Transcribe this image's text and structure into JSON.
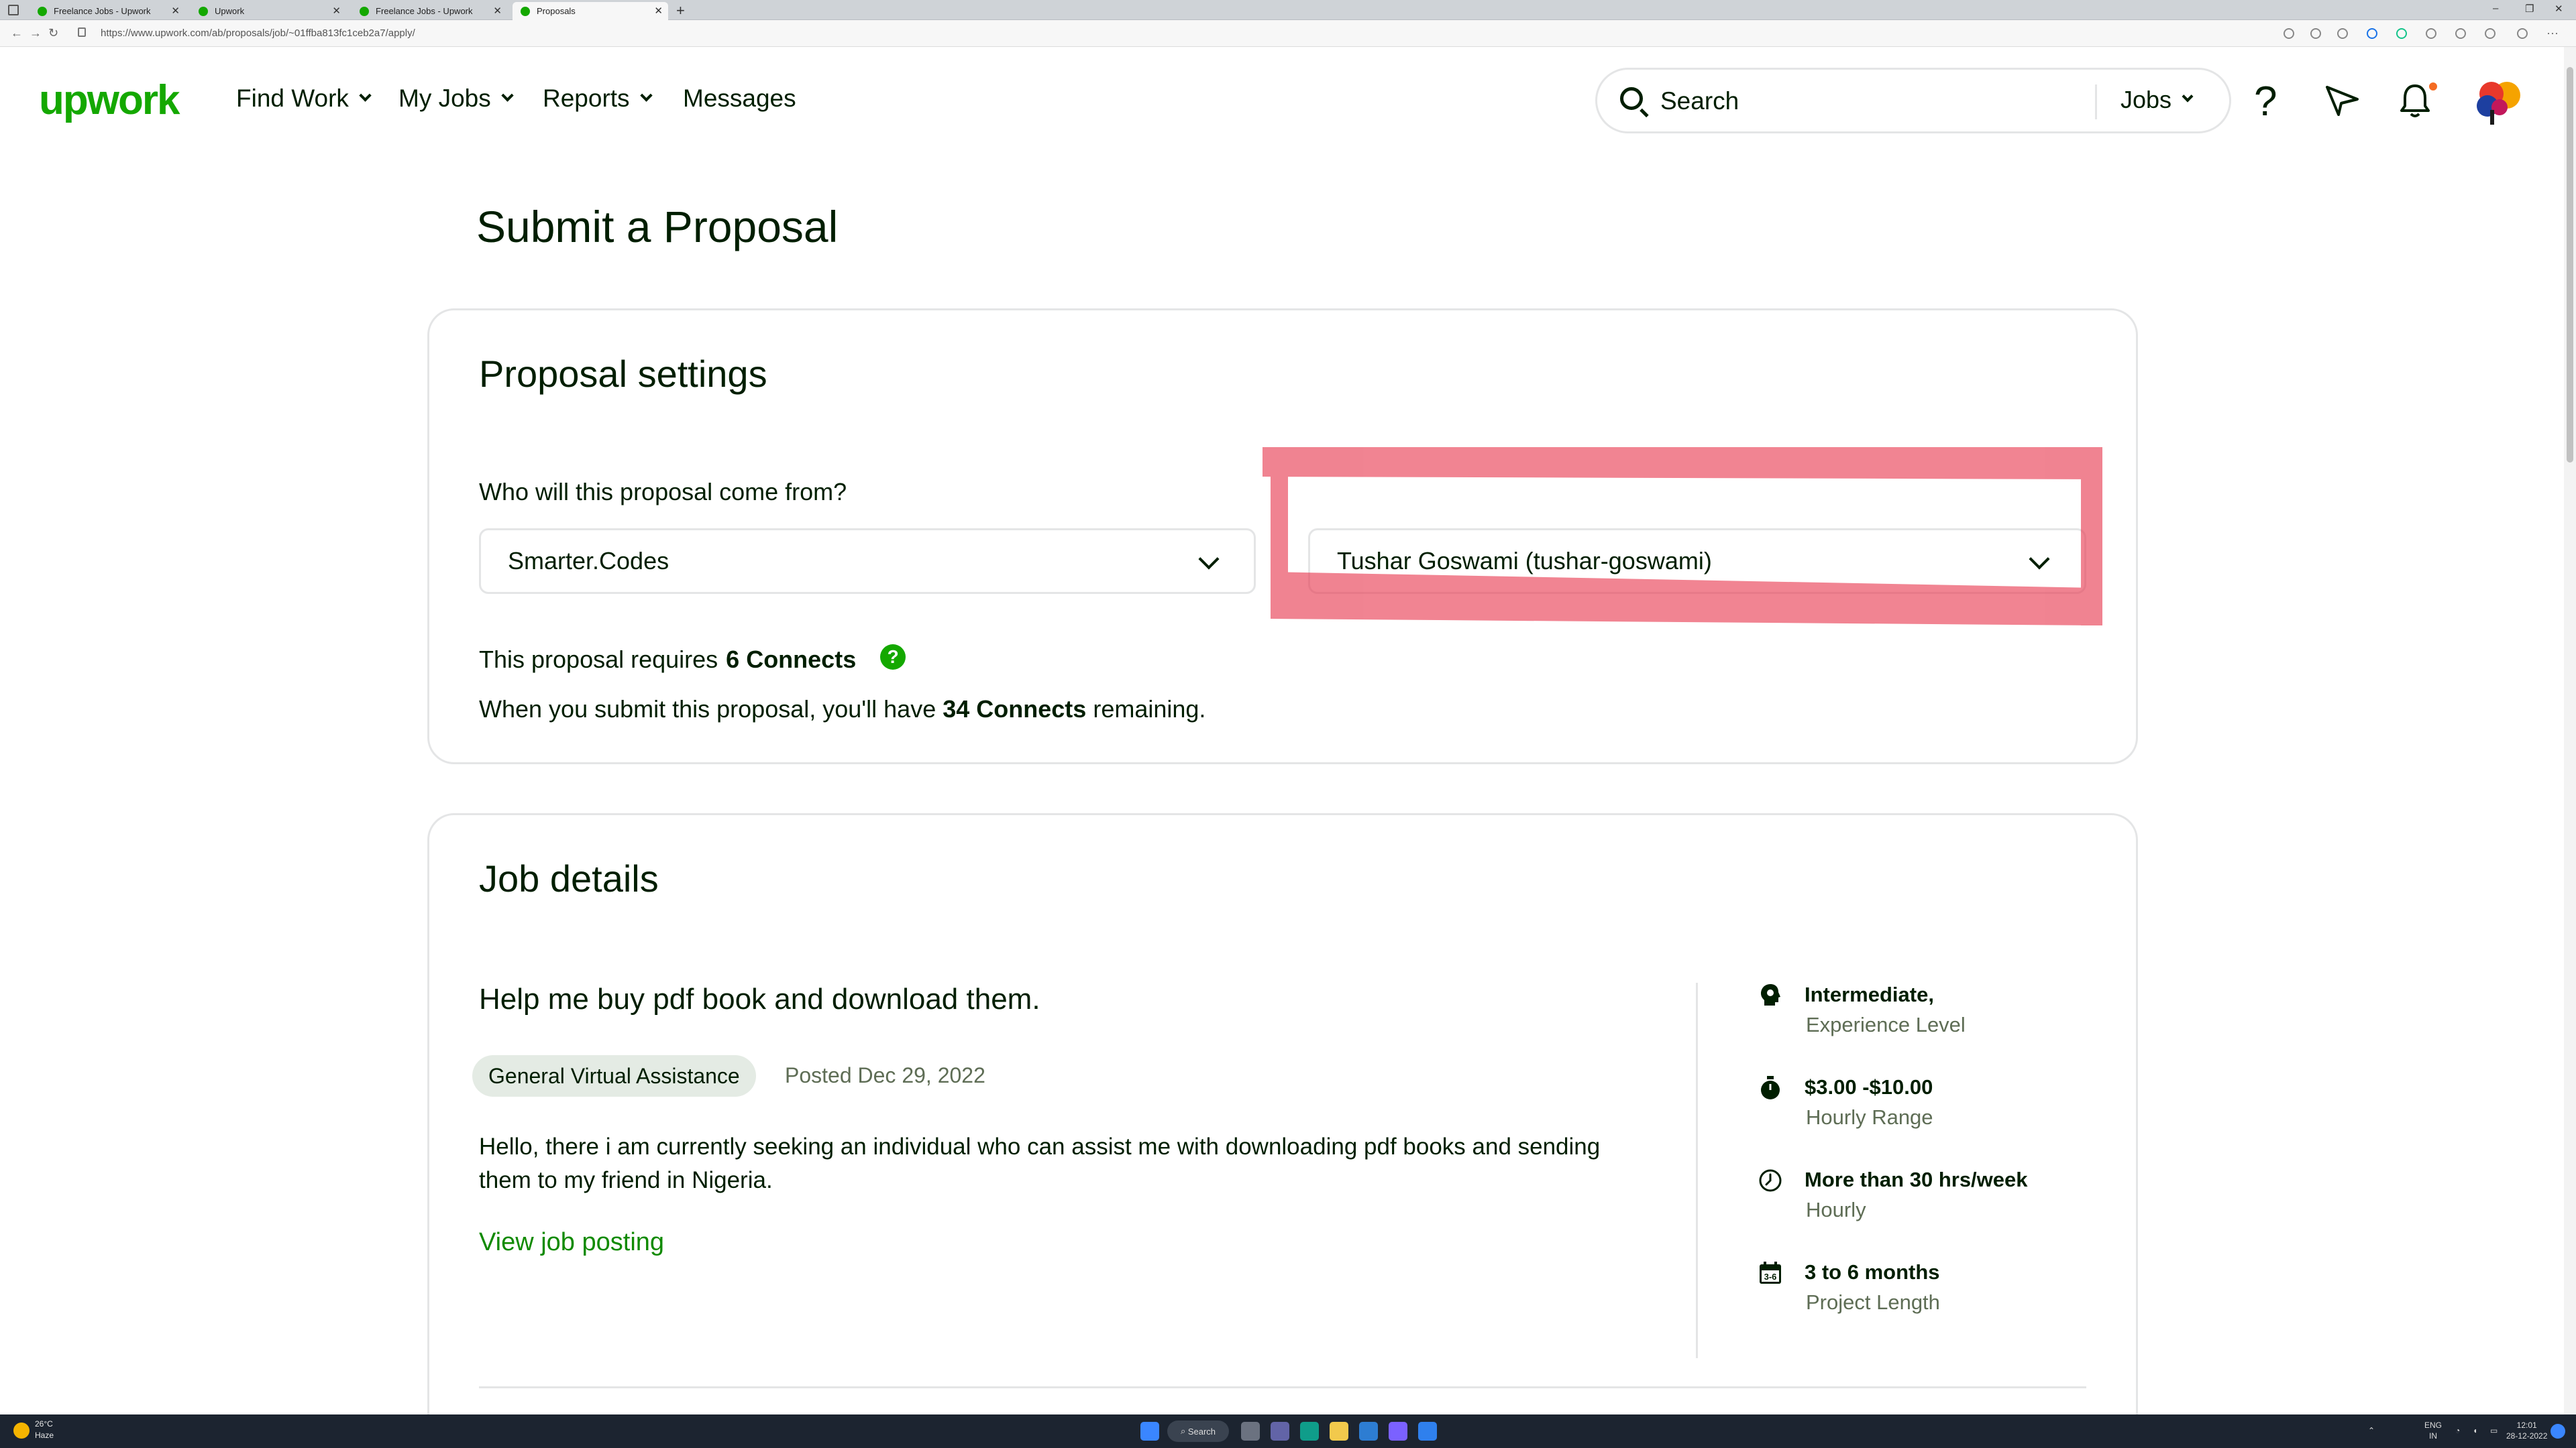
{
  "browser": {
    "tabs": [
      {
        "title": "Freelance Jobs - Upwork",
        "active": false
      },
      {
        "title": "Upwork",
        "active": false
      },
      {
        "title": "Freelance Jobs - Upwork",
        "active": false
      },
      {
        "title": "Proposals",
        "active": true
      }
    ],
    "url": "https://www.upwork.com/ab/proposals/job/~01ffba813fc1ceb2a7/apply/"
  },
  "header": {
    "logo": "upwork",
    "nav": [
      {
        "label": "Find Work",
        "has_menu": true
      },
      {
        "label": "My Jobs",
        "has_menu": true
      },
      {
        "label": "Reports",
        "has_menu": true
      },
      {
        "label": "Messages",
        "has_menu": false
      }
    ],
    "search": {
      "placeholder": "Search",
      "scope": "Jobs"
    },
    "icons": [
      "help-icon",
      "send-icon",
      "bell-icon",
      "avatar"
    ]
  },
  "page": {
    "title": "Submit a Proposal"
  },
  "proposal_settings": {
    "title": "Proposal settings",
    "from_label": "Who will this proposal come from?",
    "agency": "Smarter.Codes",
    "freelancer": "Tushar Goswami (tushar-goswami)",
    "requires_prefix": "This proposal requires",
    "requires_value": "6 Connects",
    "remaining_prefix": "When you submit this proposal, you'll have",
    "remaining_value": "34 Connects",
    "remaining_suffix": "remaining.",
    "annotation_color": "#e8384f"
  },
  "job_details": {
    "title": "Job details",
    "job_title": "Help me buy pdf book and download them.",
    "category": "General Virtual Assistance",
    "posted": "Posted Dec 29, 2022",
    "description": "Hello, there i am currently seeking an individual who can assist me with downloading pdf books and sending them to my friend in Nigeria.",
    "view_link": "View job posting",
    "attributes": [
      {
        "icon": "experience-icon",
        "value": "Intermediate,",
        "label": "Experience Level"
      },
      {
        "icon": "timer-icon",
        "value": "$3.00 -$10.00",
        "label": "Hourly Range"
      },
      {
        "icon": "clock-icon",
        "value": "More than 30 hrs/week",
        "label": "Hourly"
      },
      {
        "icon": "calendar-icon",
        "value": "3 to 6 months",
        "label": "Project Length"
      }
    ]
  },
  "taskbar": {
    "weather_temp": "26°C",
    "weather_desc": "Haze",
    "search_label": "Search",
    "lang": "ENG",
    "region": "IN",
    "time": "12:01",
    "date": "28-12-2022"
  },
  "colors": {
    "brand": "#14a800",
    "link": "#108a00",
    "text": "#001e00",
    "muted": "#5e6d55",
    "border": "#e4e5e6"
  }
}
